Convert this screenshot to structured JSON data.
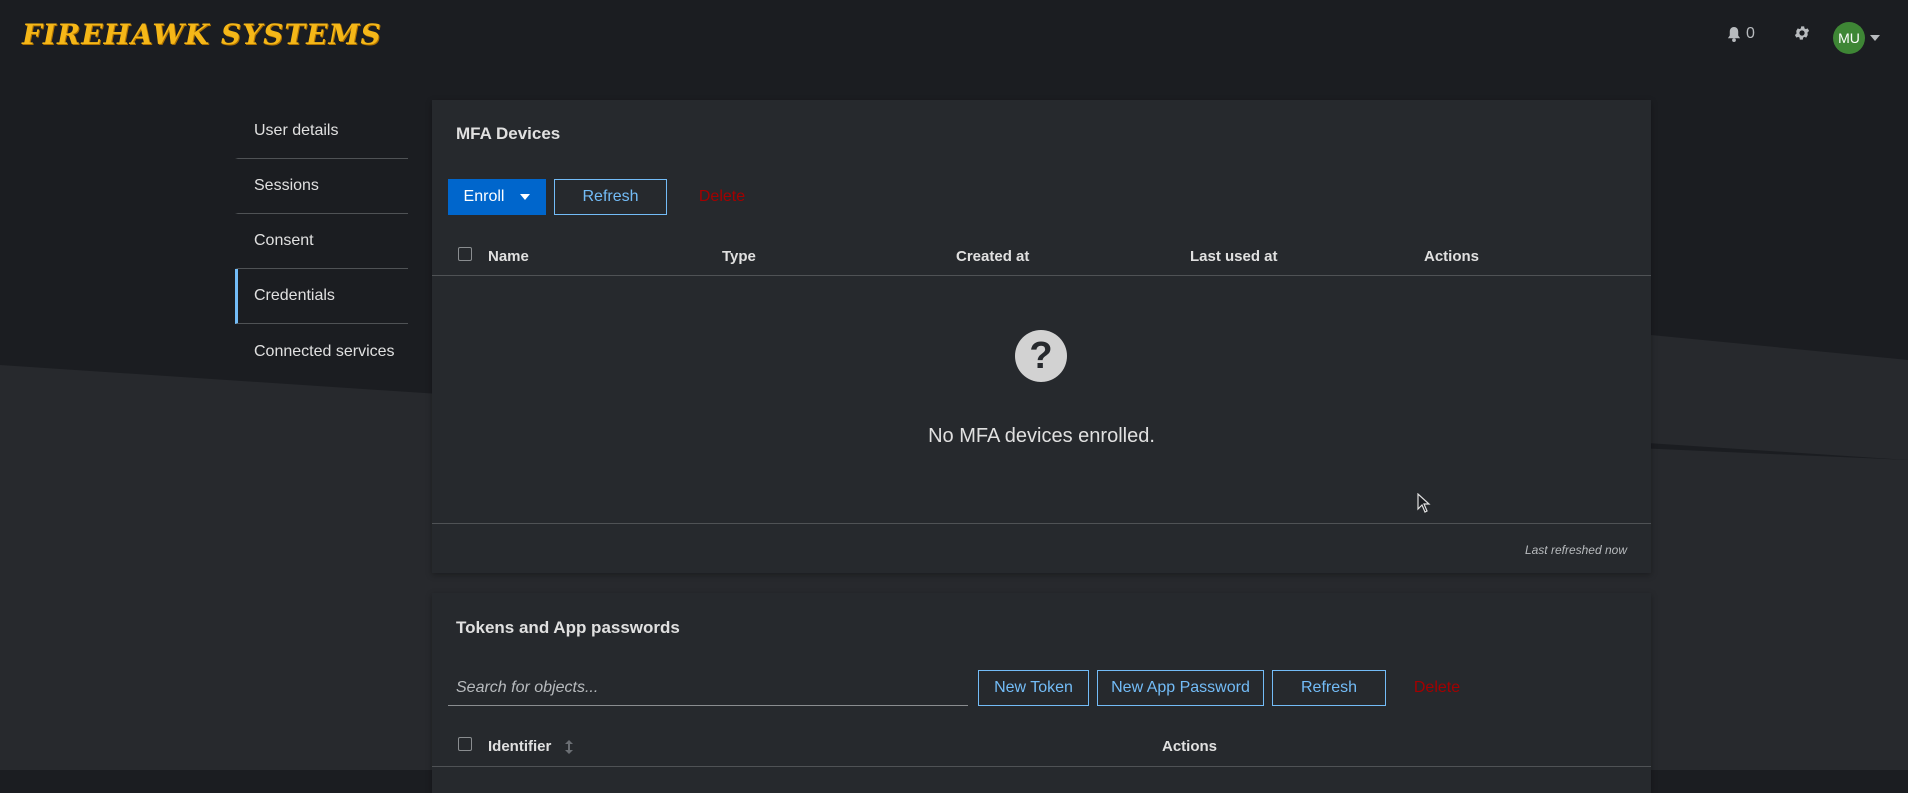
{
  "brand": {
    "name": "FIREHAWK SYSTEMS"
  },
  "header": {
    "notifications_count": "0",
    "user_initials": "MU",
    "icons": [
      "bell-icon",
      "gear-icon",
      "caret-down-icon"
    ]
  },
  "sidebar": {
    "items": [
      {
        "label": "User details"
      },
      {
        "label": "Sessions"
      },
      {
        "label": "Consent"
      },
      {
        "label": "Credentials"
      },
      {
        "label": "Connected services"
      }
    ],
    "active": "Credentials"
  },
  "mfa": {
    "title": "MFA Devices",
    "enroll_label": "Enroll",
    "refresh_label": "Refresh",
    "delete_label": "Delete",
    "columns": [
      "Name",
      "Type",
      "Created at",
      "Last used at",
      "Actions"
    ],
    "empty_text": "No MFA devices enrolled.",
    "last_refreshed": "Last refreshed now"
  },
  "tokens": {
    "title": "Tokens and App passwords",
    "search_placeholder": "Search for objects...",
    "new_token_label": "New Token",
    "new_app_password_label": "New App Password",
    "refresh_label": "Refresh",
    "delete_label": "Delete",
    "columns": [
      "Identifier",
      "Actions"
    ]
  },
  "colors": {
    "accent": "#06c",
    "link": "#73bcf7",
    "danger": "#a30000",
    "brand": "#f5b718",
    "avatar": "#3e8635"
  }
}
